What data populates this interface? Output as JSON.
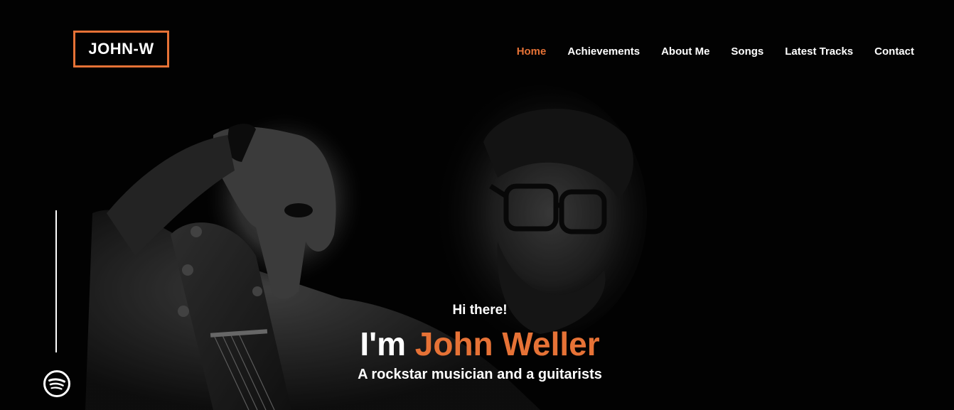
{
  "brand": {
    "logo_text": "JOHN-W",
    "accent_color": "#e67236"
  },
  "nav": {
    "items": [
      {
        "label": "Home",
        "active": true
      },
      {
        "label": "Achievements",
        "active": false
      },
      {
        "label": "About Me",
        "active": false
      },
      {
        "label": "Songs",
        "active": false
      },
      {
        "label": "Latest Tracks",
        "active": false
      },
      {
        "label": "Contact",
        "active": false
      }
    ]
  },
  "hero": {
    "greeting": "Hi there!",
    "headline_prefix": "I'm ",
    "headline_name": "John Weller",
    "tagline": "A rockstar musician and a guitarists",
    "image": "musician-with-guitar-photo"
  },
  "social": {
    "icon": "spotify-icon"
  }
}
